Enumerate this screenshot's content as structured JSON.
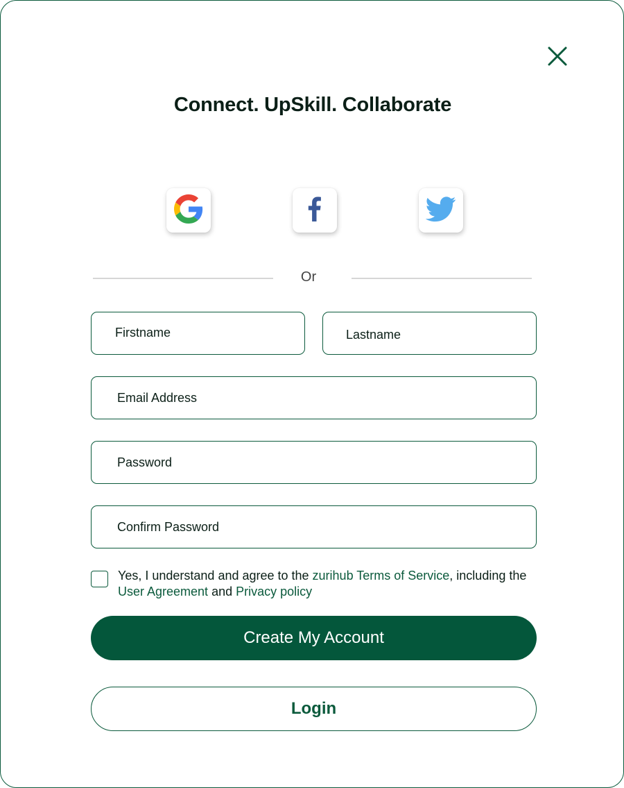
{
  "modal": {
    "title": "Connect. UpSkill. Collaborate",
    "close_icon": "close-icon"
  },
  "social": [
    {
      "provider": "Google",
      "icon": "google-icon"
    },
    {
      "provider": "Facebook",
      "icon": "facebook-icon"
    },
    {
      "provider": "Twitter",
      "icon": "twitter-icon"
    }
  ],
  "divider_text": "Or",
  "form": {
    "firstname": {
      "placeholder": "Firstname",
      "value": ""
    },
    "lastname": {
      "placeholder": "Lastname",
      "value": ""
    },
    "email": {
      "placeholder": "Email Address",
      "value": ""
    },
    "password": {
      "placeholder": "Password",
      "value": ""
    },
    "confirm_password": {
      "placeholder": "Confirm Password",
      "value": ""
    }
  },
  "agreement": {
    "checked": false,
    "text_1": "Yes, I understand and agree to the ",
    "terms_link": "zurihub Terms of Service",
    "text_2": ", including the ",
    "user_agreement_link": "User Agreement",
    "text_3": " and ",
    "privacy_link": "Privacy policy"
  },
  "buttons": {
    "create_account": "Create My Account",
    "login": "Login"
  },
  "colors": {
    "primary": "#04573b",
    "border": "#0b5a3c",
    "text": "#0b1f17",
    "twitter": "#55acee",
    "facebook": "#3b5998"
  }
}
